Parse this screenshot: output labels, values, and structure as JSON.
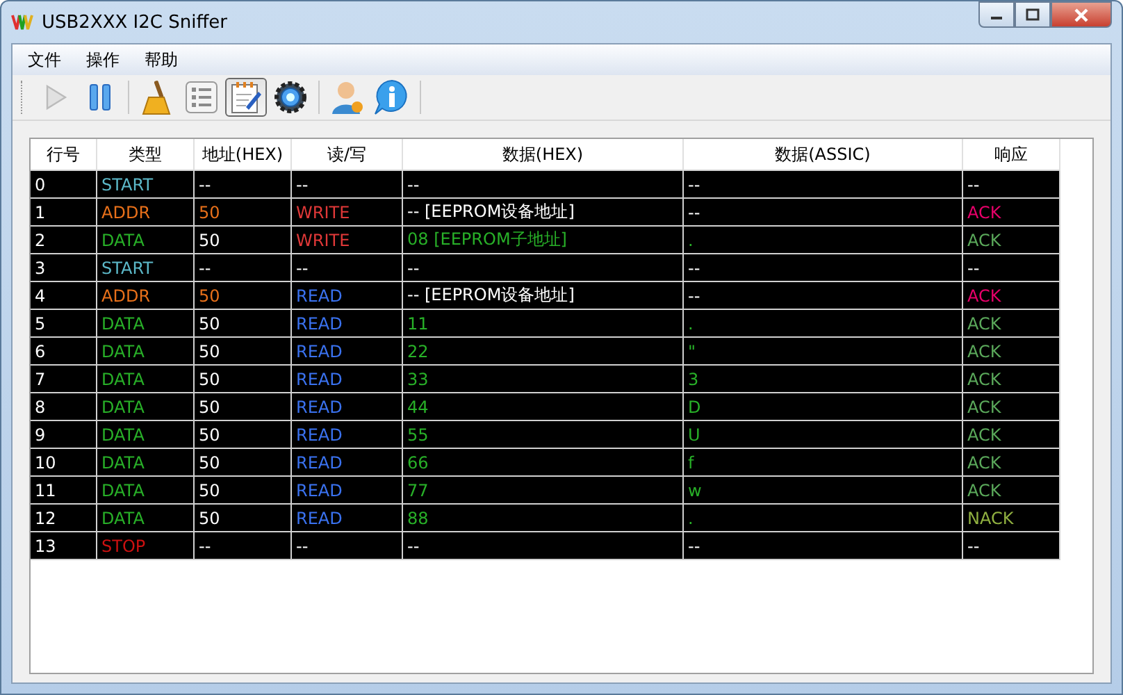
{
  "window": {
    "title": "USB2XXX I2C Sniffer"
  },
  "menu": [
    "文件",
    "操作",
    "帮助"
  ],
  "toolbar": [
    {
      "kind": "button",
      "disabled": true,
      "selected": false
    },
    {
      "kind": "button",
      "disabled": false,
      "selected": false
    },
    {
      "kind": "separator"
    },
    {
      "kind": "button",
      "disabled": false,
      "selected": false
    },
    {
      "kind": "button",
      "disabled": false,
      "selected": false
    },
    {
      "kind": "button",
      "disabled": false,
      "selected": true
    },
    {
      "kind": "button",
      "disabled": false,
      "selected": false
    },
    {
      "kind": "separator"
    },
    {
      "kind": "button",
      "disabled": false,
      "selected": false
    },
    {
      "kind": "button",
      "disabled": false,
      "selected": false
    },
    {
      "kind": "separator"
    }
  ],
  "table": {
    "columns": [
      "行号",
      "类型",
      "地址(HEX)",
      "读/写",
      "数据(HEX)",
      "数据(ASSIC)",
      "响应"
    ],
    "rows": [
      {
        "kind": "start",
        "write": false,
        "nack": false,
        "cells": [
          "0",
          "START",
          "--",
          "--",
          "--",
          "--",
          "--"
        ]
      },
      {
        "kind": "addr",
        "write": true,
        "nack": false,
        "cells": [
          "1",
          "ADDR",
          "50",
          "WRITE",
          "-- [EEPROM设备地址]",
          "--",
          "ACK"
        ]
      },
      {
        "kind": "data",
        "write": true,
        "nack": false,
        "cells": [
          "2",
          "DATA",
          "50",
          "WRITE",
          "08 [EEPROM子地址]",
          ".",
          "ACK"
        ]
      },
      {
        "kind": "start",
        "write": false,
        "nack": false,
        "cells": [
          "3",
          "START",
          "--",
          "--",
          "--",
          "--",
          "--"
        ]
      },
      {
        "kind": "addr",
        "write": false,
        "nack": false,
        "cells": [
          "4",
          "ADDR",
          "50",
          "READ",
          "-- [EEPROM设备地址]",
          "--",
          "ACK"
        ]
      },
      {
        "kind": "data",
        "write": false,
        "nack": false,
        "cells": [
          "5",
          "DATA",
          "50",
          "READ",
          "11",
          ".",
          "ACK"
        ]
      },
      {
        "kind": "data",
        "write": false,
        "nack": false,
        "cells": [
          "6",
          "DATA",
          "50",
          "READ",
          "22",
          "\"",
          "ACK"
        ]
      },
      {
        "kind": "data",
        "write": false,
        "nack": false,
        "cells": [
          "7",
          "DATA",
          "50",
          "READ",
          "33",
          "3",
          "ACK"
        ]
      },
      {
        "kind": "data",
        "write": false,
        "nack": false,
        "cells": [
          "8",
          "DATA",
          "50",
          "READ",
          "44",
          "D",
          "ACK"
        ]
      },
      {
        "kind": "data",
        "write": false,
        "nack": false,
        "cells": [
          "9",
          "DATA",
          "50",
          "READ",
          "55",
          "U",
          "ACK"
        ]
      },
      {
        "kind": "data",
        "write": false,
        "nack": false,
        "cells": [
          "10",
          "DATA",
          "50",
          "READ",
          "66",
          "f",
          "ACK"
        ]
      },
      {
        "kind": "data",
        "write": false,
        "nack": false,
        "cells": [
          "11",
          "DATA",
          "50",
          "READ",
          "77",
          "w",
          "ACK"
        ]
      },
      {
        "kind": "data",
        "write": false,
        "nack": true,
        "cells": [
          "12",
          "DATA",
          "50",
          "READ",
          "88",
          ".",
          "NACK"
        ]
      },
      {
        "kind": "stop",
        "write": false,
        "nack": false,
        "cells": [
          "13",
          "STOP",
          "--",
          "--",
          "--",
          "--",
          "--"
        ]
      }
    ]
  }
}
